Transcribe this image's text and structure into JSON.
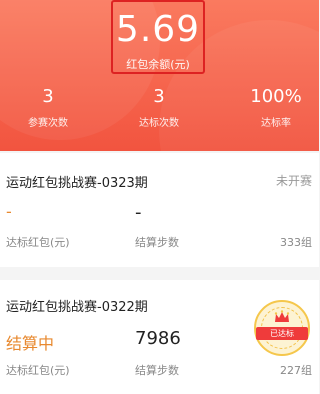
{
  "header": {
    "balance": "5.69",
    "balance_label": "红包余额(元)",
    "stats": [
      {
        "value": "3",
        "label": "参赛次数"
      },
      {
        "value": "3",
        "label": "达标次数"
      },
      {
        "value": "100%",
        "label": "达标率"
      }
    ]
  },
  "challenges": [
    {
      "title": "运动红包挑战赛-0323期",
      "status": "未开赛",
      "reward_value": "-",
      "steps_value": "-",
      "reward_label": "达标红包(元)",
      "steps_label": "结算步数",
      "groups": "333组"
    },
    {
      "title": "运动红包挑战赛-0322期",
      "reward_value": "结算中",
      "steps_value": "7986",
      "reward_label": "达标红包(元)",
      "steps_label": "结算步数",
      "groups": "227组",
      "badge": "已达标"
    }
  ],
  "colors": {
    "header_top": "#fa7a5f",
    "header_bottom": "#f2543f",
    "accent_orange": "#e8892f",
    "badge_red": "#ef3b3b"
  }
}
